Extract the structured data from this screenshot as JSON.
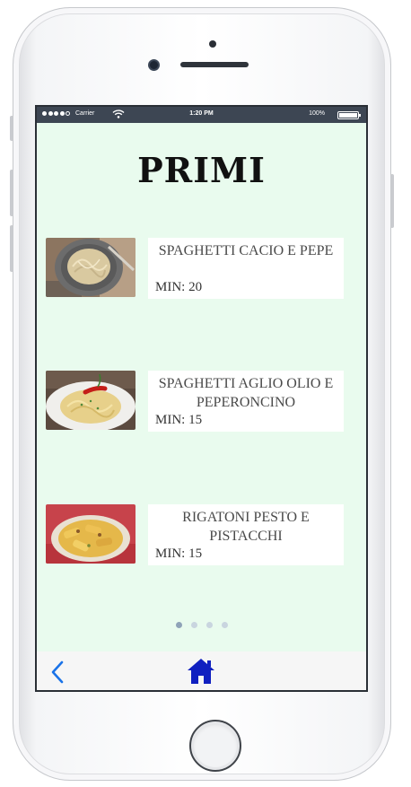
{
  "status_bar": {
    "carrier": "Carrier",
    "time": "1:20 PM",
    "battery": "100%"
  },
  "page": {
    "title": "PRIMI"
  },
  "recipes": [
    {
      "name": "SPAGHETTI CACIO E PEPE",
      "time": "MIN: 20",
      "image": "spaghetti-cacio-e-pepe-photo"
    },
    {
      "name": "SPAGHETTI AGLIO OLIO E PEPERONCINO",
      "time": "MIN: 15",
      "image": "spaghetti-aglio-olio-photo"
    },
    {
      "name": "RIGATONI PESTO E PISTACCHI",
      "time": "MIN: 15",
      "image": "rigatoni-pesto-pistacchi-photo"
    }
  ],
  "pagination": {
    "pages": 4,
    "current": 1
  },
  "toolbar": {
    "back_icon": "chevron-left-icon",
    "home_icon": "home-icon",
    "accent_color": "#1a73e8",
    "home_color": "#1020c0"
  },
  "colors": {
    "screen_background": "#e9fbee",
    "status_bar": "#3d4653"
  }
}
